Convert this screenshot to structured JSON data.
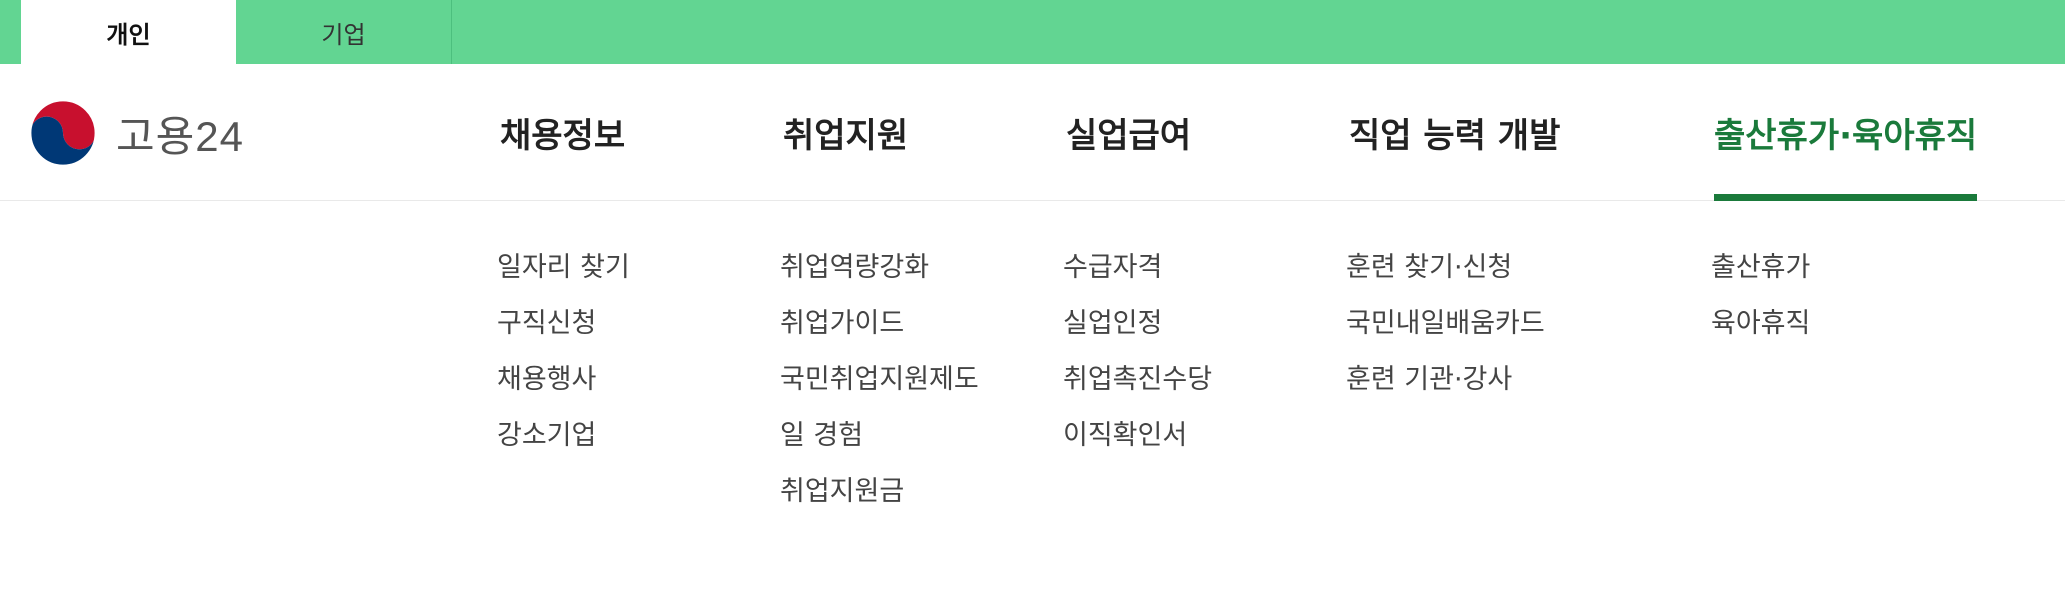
{
  "top_tabs": [
    {
      "label": "개인",
      "active": true
    },
    {
      "label": "기업",
      "active": false
    }
  ],
  "logo": {
    "text": "고용24",
    "icon": "taegeuk-emblem-icon"
  },
  "gnb": [
    {
      "label": "채용정보",
      "active": false,
      "submenu": [
        "일자리 찾기",
        "구직신청",
        "채용행사",
        "강소기업"
      ]
    },
    {
      "label": "취업지원",
      "active": false,
      "submenu": [
        "취업역량강화",
        "취업가이드",
        "국민취업지원제도",
        "일 경험",
        "취업지원금"
      ]
    },
    {
      "label": "실업급여",
      "active": false,
      "submenu": [
        "수급자격",
        "실업인정",
        "취업촉진수당",
        "이직확인서"
      ]
    },
    {
      "label": "직업 능력 개발",
      "active": false,
      "submenu": [
        "훈련 찾기·신청",
        "국민내일배움카드",
        "훈련 기관·강사"
      ]
    },
    {
      "label": "출산휴가·육아휴직",
      "active": true,
      "submenu": [
        "출산휴가",
        "육아휴직"
      ]
    }
  ],
  "colors": {
    "topbar": "#62d592",
    "active_menu": "#1a7a3b",
    "emblem_red": "#c8102e",
    "emblem_blue": "#003876"
  }
}
